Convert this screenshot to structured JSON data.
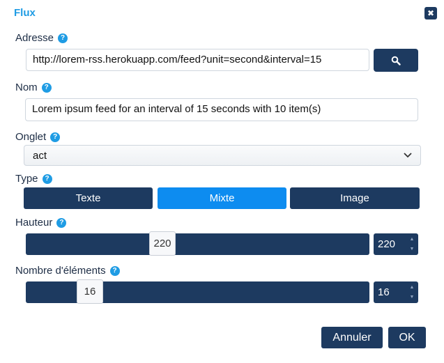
{
  "dialog": {
    "title": "Flux",
    "close_icon": "close-icon"
  },
  "address": {
    "label": "Adresse",
    "value": "http://lorem-rss.herokuapp.com/feed?unit=second&interval=15",
    "search_icon": "search-icon"
  },
  "name": {
    "label": "Nom",
    "value": "Lorem ipsum feed for an interval of 15 seconds with 10 item(s)"
  },
  "tab": {
    "label": "Onglet",
    "selected": "act"
  },
  "type": {
    "label": "Type",
    "options": [
      "Texte",
      "Mixte",
      "Image"
    ],
    "selected": "Mixte"
  },
  "height": {
    "label": "Hauteur",
    "value": "220",
    "fraction": 0.39
  },
  "count": {
    "label": "Nombre d'éléments",
    "value": "16",
    "fraction": 0.16
  },
  "footer": {
    "cancel_label": "Annuler",
    "ok_label": "OK"
  },
  "colors": {
    "accent": "#1f9ce4",
    "button": "#1d3a60",
    "active": "#0d8cf0"
  }
}
